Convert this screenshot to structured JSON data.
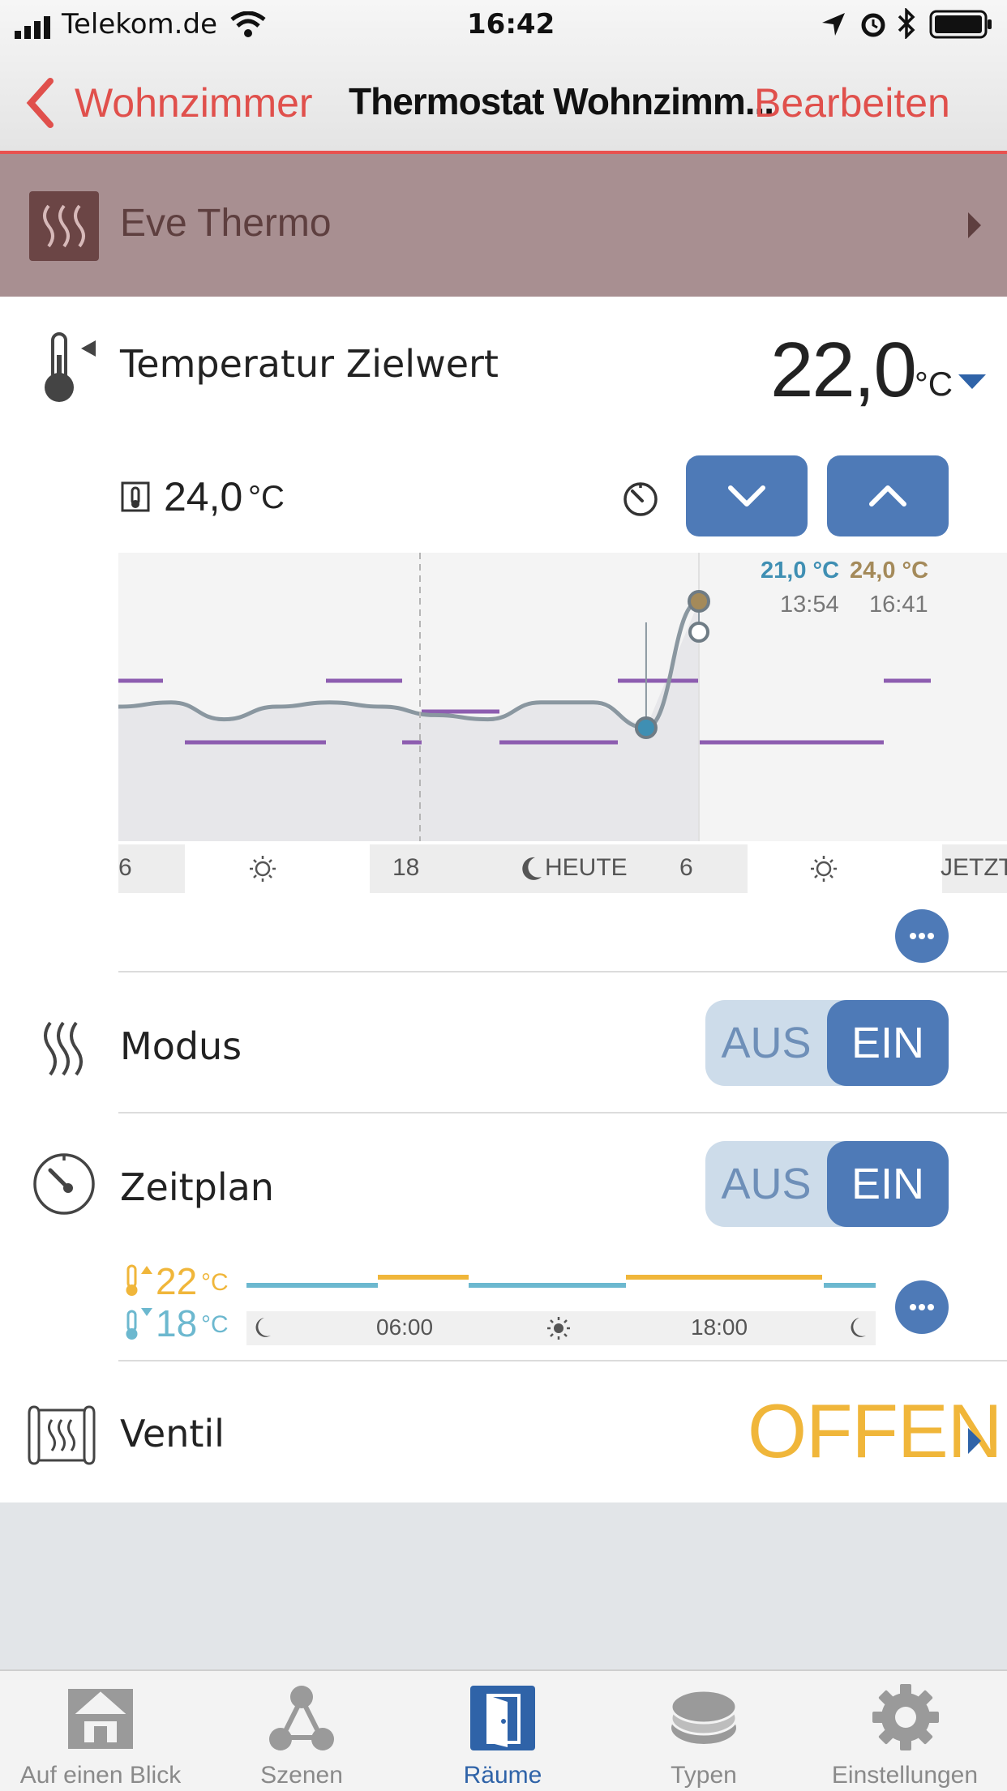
{
  "status_bar": {
    "carrier": "Telekom.de",
    "time": "16:42"
  },
  "nav": {
    "back_label": "Wohnzimmer",
    "title": "Thermostat Wohnzimm...",
    "edit_label": "Bearbeiten"
  },
  "device": {
    "name": "Eve Thermo"
  },
  "target": {
    "label": "Temperatur Zielwert",
    "value": "22,0",
    "unit": "°C"
  },
  "current_temp": {
    "value": "24,0",
    "unit": "°C"
  },
  "history_chart": {
    "markers": [
      {
        "temp": "21,0 °C",
        "time": "13:54",
        "color": "#3f8fb3"
      },
      {
        "temp": "24,0 °C",
        "time": "16:41",
        "color": "#a48a5a"
      }
    ],
    "axis_labels": [
      "6",
      "18",
      "HEUTE",
      "6",
      "JETZT"
    ]
  },
  "chart_data": {
    "type": "line",
    "x_labels": [
      "6",
      "18",
      "HEUTE",
      "6",
      "JETZT"
    ],
    "series": [
      {
        "values": [
          21.5,
          21.6,
          21.2,
          21.5,
          21.6,
          21.5,
          21.3,
          21.2,
          21.6,
          21.6,
          21.0,
          24.0
        ]
      }
    ],
    "annotations": [
      {
        "temp": "21,0 °C",
        "time": "13:54"
      },
      {
        "temp": "24,0 °C",
        "time": "16:41"
      }
    ]
  },
  "modus": {
    "label": "Modus",
    "off": "AUS",
    "on": "EIN",
    "state": "EIN"
  },
  "zeitplan": {
    "label": "Zeitplan",
    "off": "AUS",
    "on": "EIN",
    "state": "EIN",
    "high_temp": "22",
    "low_temp": "18",
    "unit": "°C",
    "times": [
      "06:00",
      "18:00"
    ]
  },
  "ventil": {
    "label": "Ventil",
    "value": "OFFEN",
    "value_color": "#f0b63a"
  },
  "tabs": [
    {
      "label": "Auf einen Blick",
      "icon": "house-icon"
    },
    {
      "label": "Szenen",
      "icon": "scenes-icon"
    },
    {
      "label": "Räume",
      "icon": "door-icon",
      "active": true
    },
    {
      "label": "Typen",
      "icon": "layers-icon"
    },
    {
      "label": "Einstellungen",
      "icon": "gear-icon"
    }
  ],
  "colors": {
    "accent": "#e0504c",
    "blue": "#4e7ab7",
    "orange": "#f0b63a",
    "purple": "#8d5db0",
    "teal": "#6cb8cf"
  }
}
